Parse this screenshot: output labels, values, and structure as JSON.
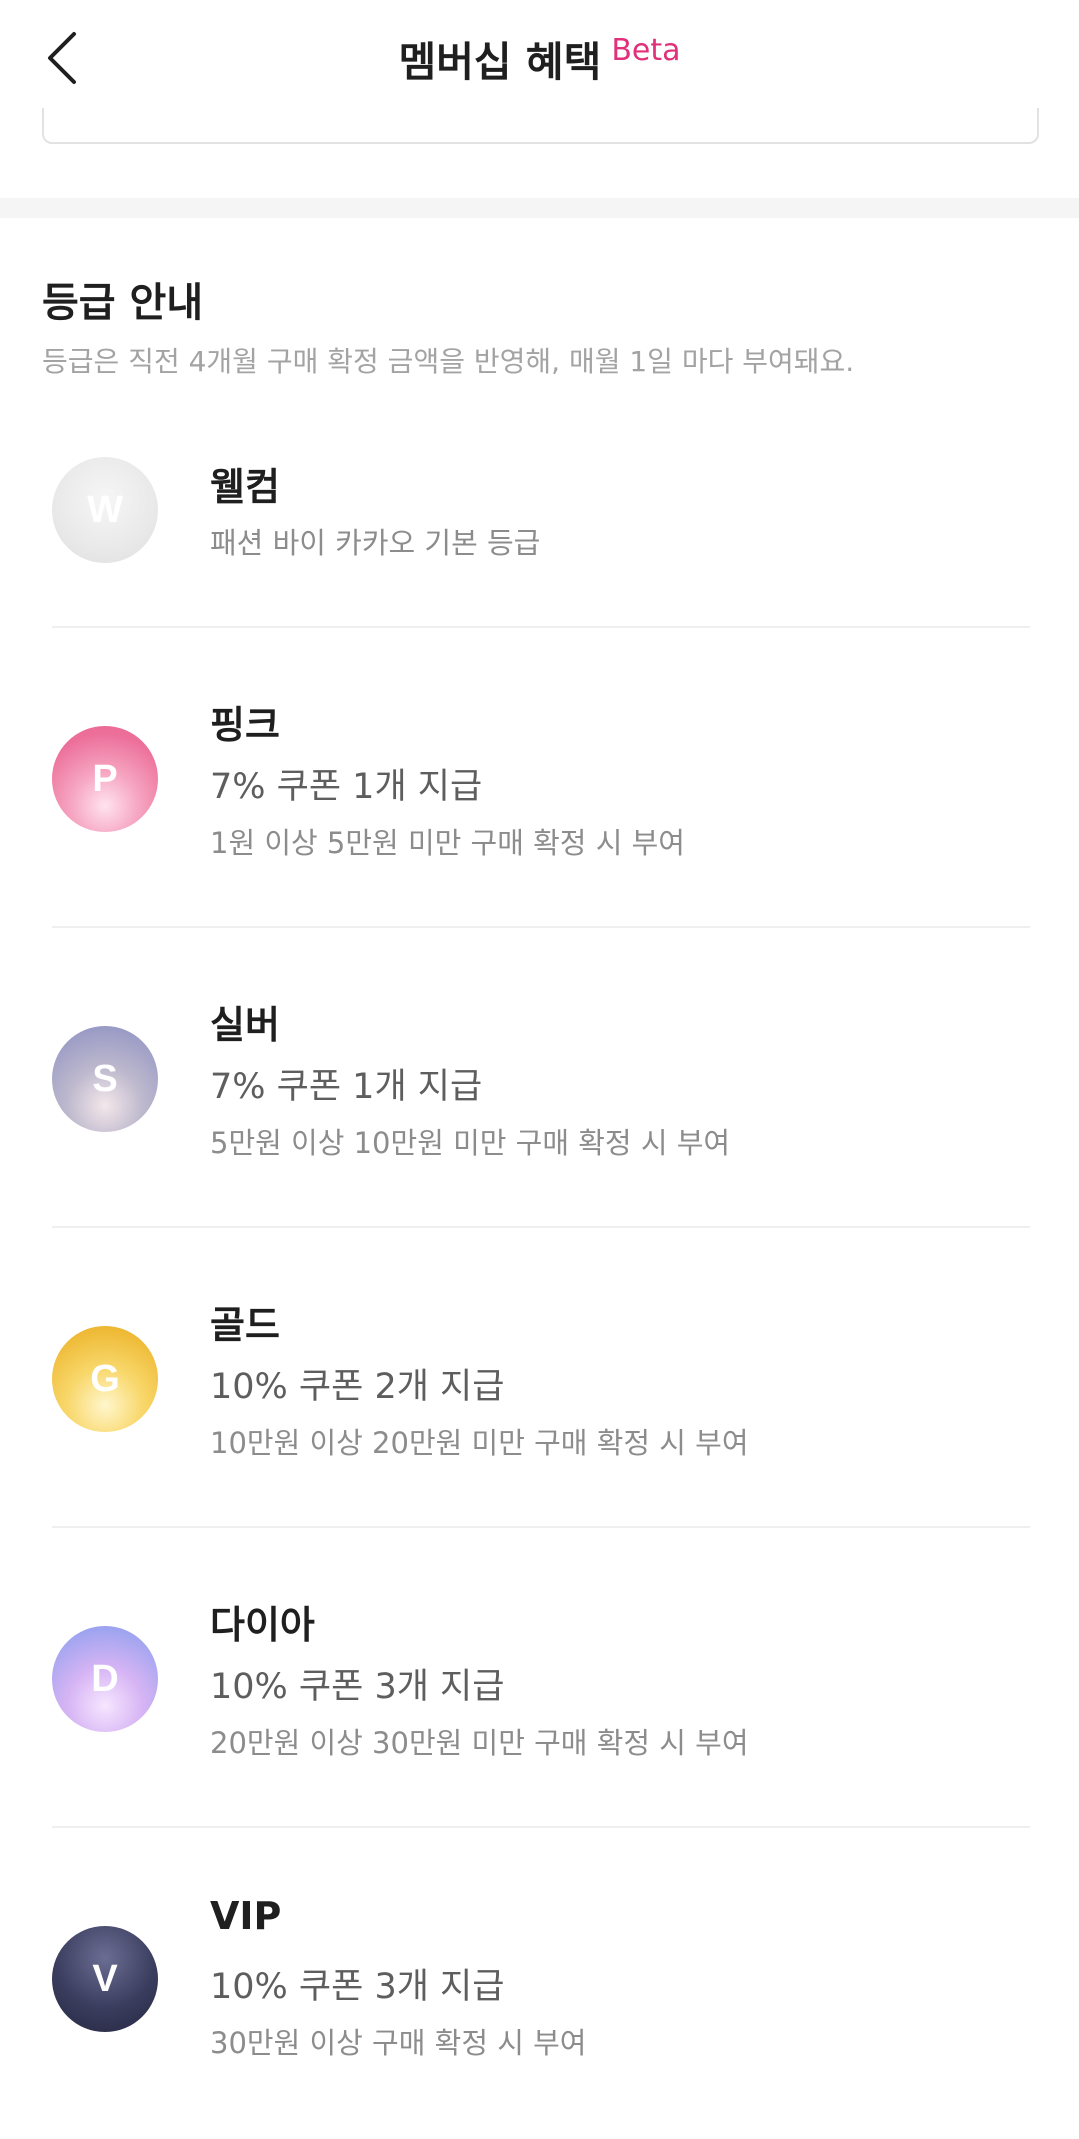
{
  "header": {
    "title": "멤버십 혜택",
    "badge": "Beta",
    "back_icon": "chevron-left-icon"
  },
  "grade_section": {
    "title": "등급 안내",
    "description": "등급은 직전 4개월 구매 확정 금액을 반영해, 매월 1일 마다 부여돼요."
  },
  "tiers": [
    {
      "letter": "W",
      "name": "웰컴",
      "benefit": "",
      "condition": "패션 바이 카카오 기본 등급"
    },
    {
      "letter": "P",
      "name": "핑크",
      "benefit": "7% 쿠폰 1개 지급",
      "condition": "1원 이상 5만원 미만 구매 확정 시 부여"
    },
    {
      "letter": "S",
      "name": "실버",
      "benefit": "7% 쿠폰 1개 지급",
      "condition": "5만원 이상 10만원 미만 구매 확정 시 부여"
    },
    {
      "letter": "G",
      "name": "골드",
      "benefit": "10% 쿠폰 2개 지급",
      "condition": "10만원 이상 20만원 미만 구매 확정 시 부여"
    },
    {
      "letter": "D",
      "name": "다이아",
      "benefit": "10% 쿠폰 3개 지급",
      "condition": "20만원 이상 30만원 미만 구매 확정 시 부여"
    },
    {
      "letter": "V",
      "name": "VIP",
      "benefit": "10% 쿠폰 3개 지급",
      "condition": "30만원 이상 구매 확정 시 부여"
    }
  ],
  "colors": {
    "accent": "#e0317a",
    "welcome": "#e6e6e6",
    "pink": "#ec6f9a",
    "silver": "#9b9cc6",
    "gold": "#eeb935",
    "dia": "#9fa4f0",
    "vip": "#2e3050"
  }
}
